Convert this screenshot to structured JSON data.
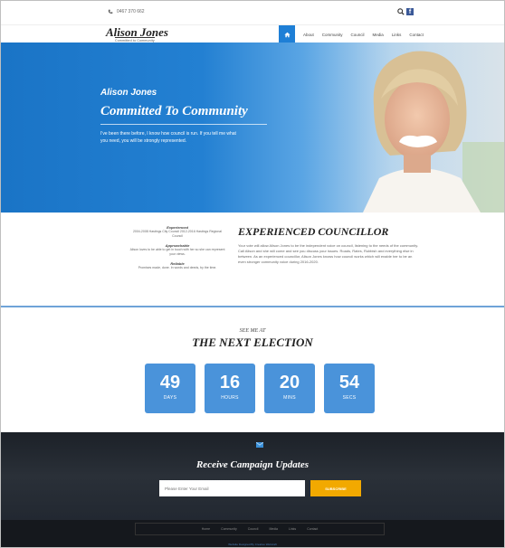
{
  "topbar": {
    "phone": "0467 370 662"
  },
  "header": {
    "logo_name": "Alison Jones",
    "logo_tagline": "Committed to Community",
    "nav": [
      "About",
      "Community",
      "Council",
      "Media",
      "Links",
      "Contact"
    ]
  },
  "hero": {
    "name": "Alison Jones",
    "slogan": "Committed To Community",
    "text": "I've been there before, I know how council is run. If you tell me what you need, you will be strongly represented."
  },
  "experience": {
    "left": [
      {
        "heading": "Experienced",
        "text": "2004-2008 Hastings City Council 2012-2016 Hastings Regional Council"
      },
      {
        "heading": "Approachable",
        "text": "Alison loves to be able to get in touch with her so she can represent your views."
      },
      {
        "heading": "Reliable",
        "text": "Promises made, done. In words and deeds, by the time."
      }
    ],
    "title": "EXPERIENCED COUNCILLOR",
    "text": "Your vote will allow Alison Jones to be the independent voice on council, listening to the needs of the community. Call Alison and she will come and see you discuss your issues. Roads, Rates, Rubbish and everything else in between. As an experienced councillor, Alison Jones knows how council works which will enable her to be an even stronger community voice during 2016-2020."
  },
  "countdown": {
    "kicker": "SEE ME AT",
    "title": "THE NEXT ELECTION",
    "boxes": [
      {
        "value": "49",
        "label": "DAYS"
      },
      {
        "value": "16",
        "label": "HOURS"
      },
      {
        "value": "20",
        "label": "MINS"
      },
      {
        "value": "54",
        "label": "SECS"
      }
    ]
  },
  "updates": {
    "title": "Receive Campaign Updates",
    "placeholder": "Please Enter Your Email",
    "button": "SUBSCRIBE"
  },
  "footer": {
    "nav": [
      "Home",
      "Community",
      "Council",
      "Media",
      "Links",
      "Contact"
    ],
    "credit": "Website Designed By Creative Webcraft"
  },
  "colors": {
    "accent": "#1e7fd6",
    "countdown_box": "#4a93da",
    "subscribe": "#f2a900",
    "footer": "#15181d"
  }
}
